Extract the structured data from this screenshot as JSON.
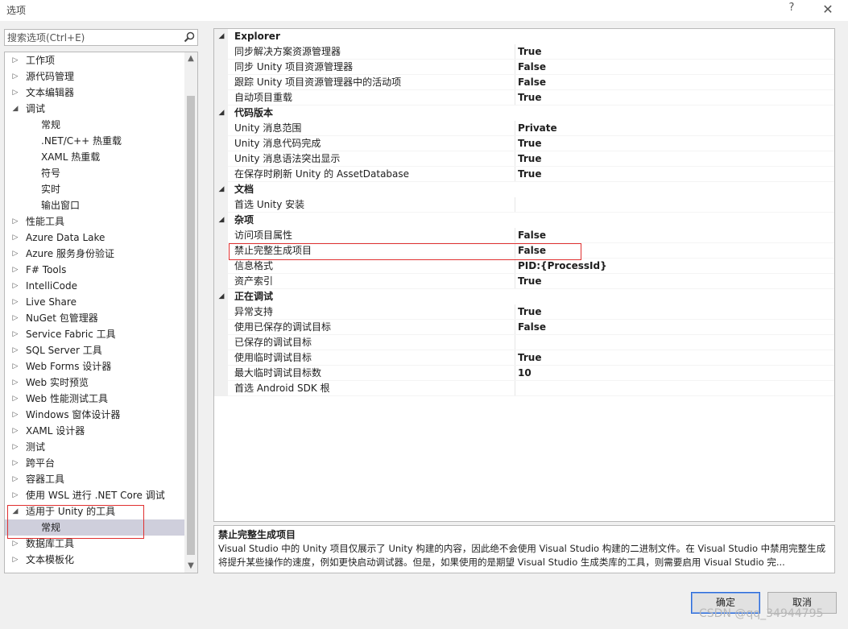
{
  "window": {
    "title": "选项",
    "help_label": "?",
    "close_label": "✕"
  },
  "search": {
    "placeholder": "搜索选项(Ctrl+E)"
  },
  "tree": {
    "items": [
      {
        "label": "工作项",
        "level": 0,
        "arrow": "▷"
      },
      {
        "label": "源代码管理",
        "level": 0,
        "arrow": "▷"
      },
      {
        "label": "文本编辑器",
        "level": 0,
        "arrow": "▷"
      },
      {
        "label": "调试",
        "level": 0,
        "arrow": "◢"
      },
      {
        "label": "常规",
        "level": 1,
        "arrow": ""
      },
      {
        "label": ".NET/C++ 热重载",
        "level": 1,
        "arrow": ""
      },
      {
        "label": "XAML 热重载",
        "level": 1,
        "arrow": ""
      },
      {
        "label": "符号",
        "level": 1,
        "arrow": ""
      },
      {
        "label": "实时",
        "level": 1,
        "arrow": ""
      },
      {
        "label": "输出窗口",
        "level": 1,
        "arrow": ""
      },
      {
        "label": "性能工具",
        "level": 0,
        "arrow": "▷"
      },
      {
        "label": "Azure Data Lake",
        "level": 0,
        "arrow": "▷"
      },
      {
        "label": "Azure 服务身份验证",
        "level": 0,
        "arrow": "▷"
      },
      {
        "label": "F# Tools",
        "level": 0,
        "arrow": "▷"
      },
      {
        "label": "IntelliCode",
        "level": 0,
        "arrow": "▷"
      },
      {
        "label": "Live Share",
        "level": 0,
        "arrow": "▷"
      },
      {
        "label": "NuGet 包管理器",
        "level": 0,
        "arrow": "▷"
      },
      {
        "label": "Service Fabric 工具",
        "level": 0,
        "arrow": "▷"
      },
      {
        "label": "SQL Server 工具",
        "level": 0,
        "arrow": "▷"
      },
      {
        "label": "Web Forms 设计器",
        "level": 0,
        "arrow": "▷"
      },
      {
        "label": "Web 实时预览",
        "level": 0,
        "arrow": "▷"
      },
      {
        "label": "Web 性能测试工具",
        "level": 0,
        "arrow": "▷"
      },
      {
        "label": "Windows 窗体设计器",
        "level": 0,
        "arrow": "▷"
      },
      {
        "label": "XAML 设计器",
        "level": 0,
        "arrow": "▷"
      },
      {
        "label": "测试",
        "level": 0,
        "arrow": "▷"
      },
      {
        "label": "跨平台",
        "level": 0,
        "arrow": "▷"
      },
      {
        "label": "容器工具",
        "level": 0,
        "arrow": "▷"
      },
      {
        "label": "使用 WSL 进行 .NET Core 调试",
        "level": 0,
        "arrow": "▷"
      },
      {
        "label": "适用于 Unity 的工具",
        "level": 0,
        "arrow": "◢"
      },
      {
        "label": "常规",
        "level": 1,
        "arrow": "",
        "selected": true
      },
      {
        "label": "数据库工具",
        "level": 0,
        "arrow": "▷"
      },
      {
        "label": "文本模板化",
        "level": 0,
        "arrow": "▷"
      }
    ],
    "scroll_up": "▲",
    "scroll_down": "▼"
  },
  "properties": [
    {
      "category": "Explorer",
      "rows": [
        {
          "name": "同步解决方案资源管理器",
          "value": "True"
        },
        {
          "name": "同步 Unity 项目资源管理器",
          "value": "False"
        },
        {
          "name": "跟踪 Unity 项目资源管理器中的活动项",
          "value": "False"
        },
        {
          "name": "自动项目重载",
          "value": "True"
        }
      ]
    },
    {
      "category": "代码版本",
      "rows": [
        {
          "name": "Unity 消息范围",
          "value": "Private"
        },
        {
          "name": "Unity 消息代码完成",
          "value": "True"
        },
        {
          "name": "Unity 消息语法突出显示",
          "value": "True"
        },
        {
          "name": "在保存时刷新 Unity 的 AssetDatabase",
          "value": "True"
        }
      ]
    },
    {
      "category": "文档",
      "rows": [
        {
          "name": "首选 Unity 安装",
          "value": ""
        }
      ]
    },
    {
      "category": "杂项",
      "rows": [
        {
          "name": "访问项目属性",
          "value": "False"
        },
        {
          "name": "禁止完整生成项目",
          "value": "False"
        },
        {
          "name": "信息格式",
          "value": "PID:{ProcessId}"
        },
        {
          "name": "资产索引",
          "value": "True"
        }
      ]
    },
    {
      "category": "正在调试",
      "rows": [
        {
          "name": "异常支持",
          "value": "True"
        },
        {
          "name": "使用已保存的调试目标",
          "value": "False"
        },
        {
          "name": "已保存的调试目标",
          "value": ""
        },
        {
          "name": "使用临时调试目标",
          "value": "True"
        },
        {
          "name": "最大临时调试目标数",
          "value": "10"
        },
        {
          "name": "首选 Android SDK 根",
          "value": ""
        }
      ]
    }
  ],
  "category_arrow": "◢",
  "description": {
    "title": "禁止完整生成项目",
    "text": "Visual Studio 中的 Unity 项目仅展示了 Unity 构建的内容，因此绝不会使用 Visual Studio 构建的二进制文件。在 Visual Studio 中禁用完整生成将提升某些操作的速度，例如更快启动调试器。但是，如果使用的是期望 Visual Studio 生成类库的工具，则需要启用 Visual Studio 完..."
  },
  "buttons": {
    "ok_label": "确定",
    "cancel_label": "取消"
  },
  "watermark": "CSDN @qq_34944795",
  "colors": {
    "highlight": "#e03030",
    "selection": "#cfcfdc",
    "ok_border": "#2a6ad8"
  }
}
